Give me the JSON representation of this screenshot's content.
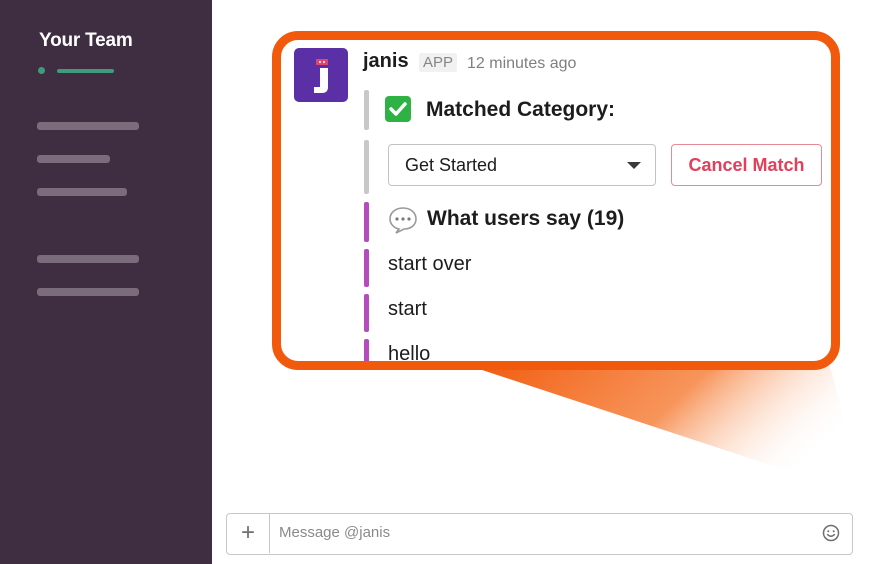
{
  "sidebar": {
    "team_name": "Your Team",
    "colors": {
      "background": "#3f2e41",
      "status": "#3f9a7e",
      "placeholder_bars": "#7a6c7b"
    }
  },
  "message": {
    "author": "janis",
    "badge": "APP",
    "timestamp": "12 minutes ago",
    "avatar_icon": "janis-logo-icon",
    "avatar_color": "#5b2fa6",
    "matched_icon": "white-check-mark-icon",
    "matched_label": "Matched Category:",
    "category_select": {
      "value": "Get Started"
    },
    "cancel_button": "Cancel Match",
    "users_say_icon": "speech-balloon-icon",
    "users_say_label": "What users say (19)",
    "utterances": [
      "start over",
      "start",
      "hello"
    ]
  },
  "composer": {
    "add_icon": "+",
    "placeholder": "Message @janis",
    "emoji_icon": "smiley-icon"
  },
  "colors": {
    "callout_border": "#f15a0c",
    "grey_attachment": "#c8c8c8",
    "purple_attachment": "#b64bbd",
    "cancel_text": "#e0405a",
    "check_green": "#2eb245"
  }
}
